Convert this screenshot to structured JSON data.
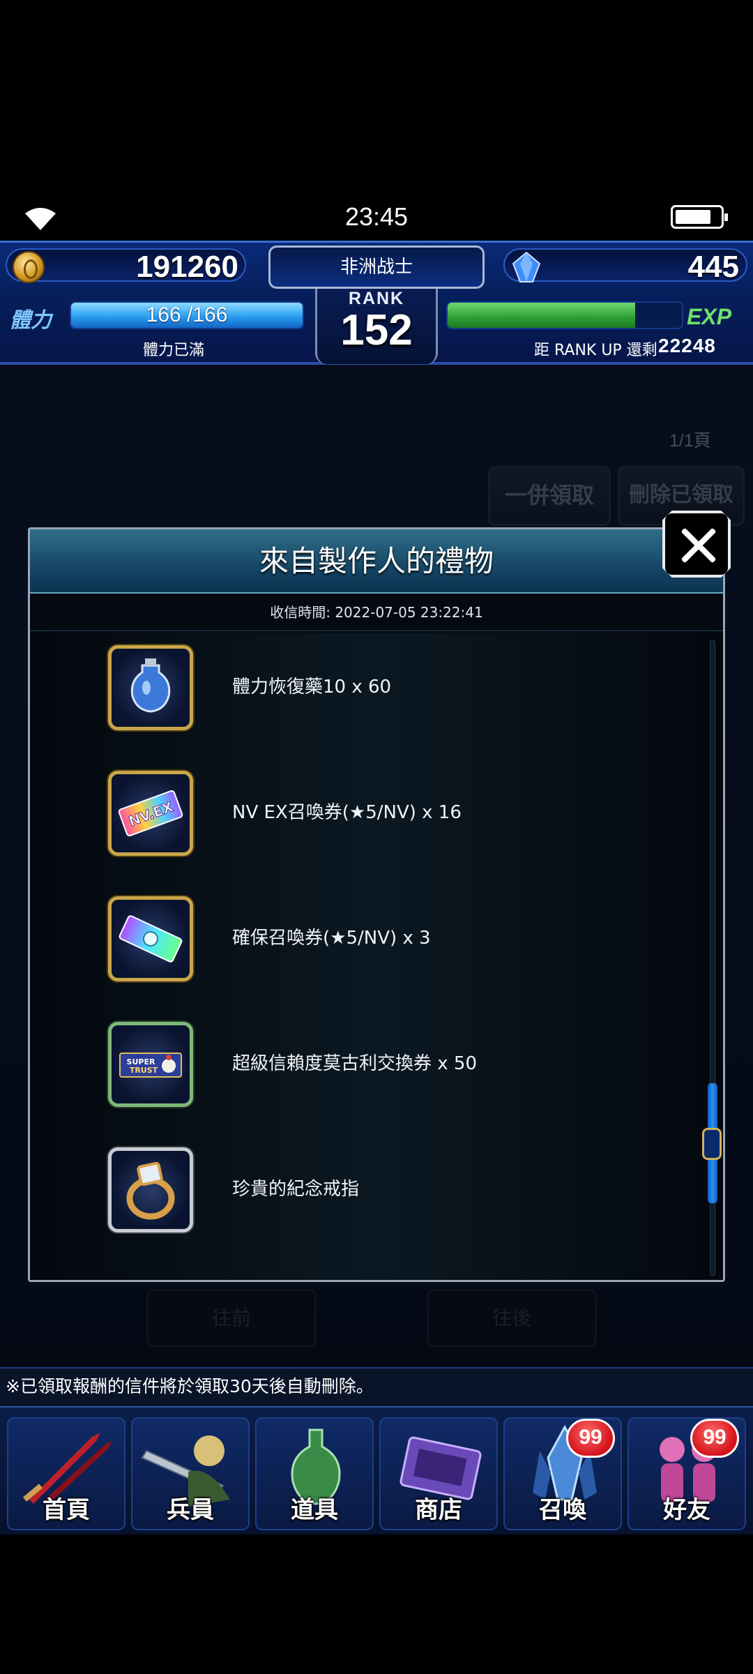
{
  "status_bar": {
    "time": "23:45"
  },
  "header": {
    "gil": "191260",
    "player_name": "非洲战士",
    "gems": "445",
    "rank_label": "RANK",
    "rank": "152",
    "stamina_label": "體力",
    "stamina": "166 /166",
    "stamina_percent": 100,
    "stamina_status": "體力已滿",
    "exp_label": "EXP",
    "exp_percent": 80,
    "exp_remaining_label": "距 RANK UP 還剩",
    "exp_remaining": "22248"
  },
  "mailbox": {
    "page_indicator": "1/1頁",
    "batch_claim_label": "一併領取",
    "delete_claimed_label": "刪除已領取",
    "prev_label": "往前",
    "next_label": "往後",
    "notice": "※已領取報酬的信件將於領取30天後自動刪除。"
  },
  "modal": {
    "title": "來自製作人的禮物",
    "received_time": "收信時間: 2022-07-05 23:22:41",
    "items": [
      {
        "label": "體力恢復藥10 x 60",
        "icon": "stamina-potion-icon"
      },
      {
        "label": "NV EX召喚券(★5/NV) x 16",
        "icon": "nv-ex-ticket-icon"
      },
      {
        "label": "確保召喚券(★5/NV) x 3",
        "icon": "guaranteed-ticket-icon"
      },
      {
        "label": "超級信賴度莫古利交換券 x 50",
        "icon": "super-trust-moogle-ticket-icon"
      },
      {
        "label": "珍貴的紀念戒指",
        "icon": "memorial-ring-icon"
      }
    ]
  },
  "nav": [
    {
      "label": "首頁",
      "icon": "home-icon",
      "badge": ""
    },
    {
      "label": "兵員",
      "icon": "units-icon",
      "badge": ""
    },
    {
      "label": "道具",
      "icon": "items-icon",
      "badge": ""
    },
    {
      "label": "商店",
      "icon": "shop-icon",
      "badge": ""
    },
    {
      "label": "召喚",
      "icon": "summon-icon",
      "badge": "99"
    },
    {
      "label": "好友",
      "icon": "friends-icon",
      "badge": "99"
    }
  ],
  "colors": {
    "accent_blue": "#2a9ff0",
    "exp_green": "#2e9e32",
    "badge_red": "#d4121a",
    "gold_frame": "#c9a64a"
  }
}
